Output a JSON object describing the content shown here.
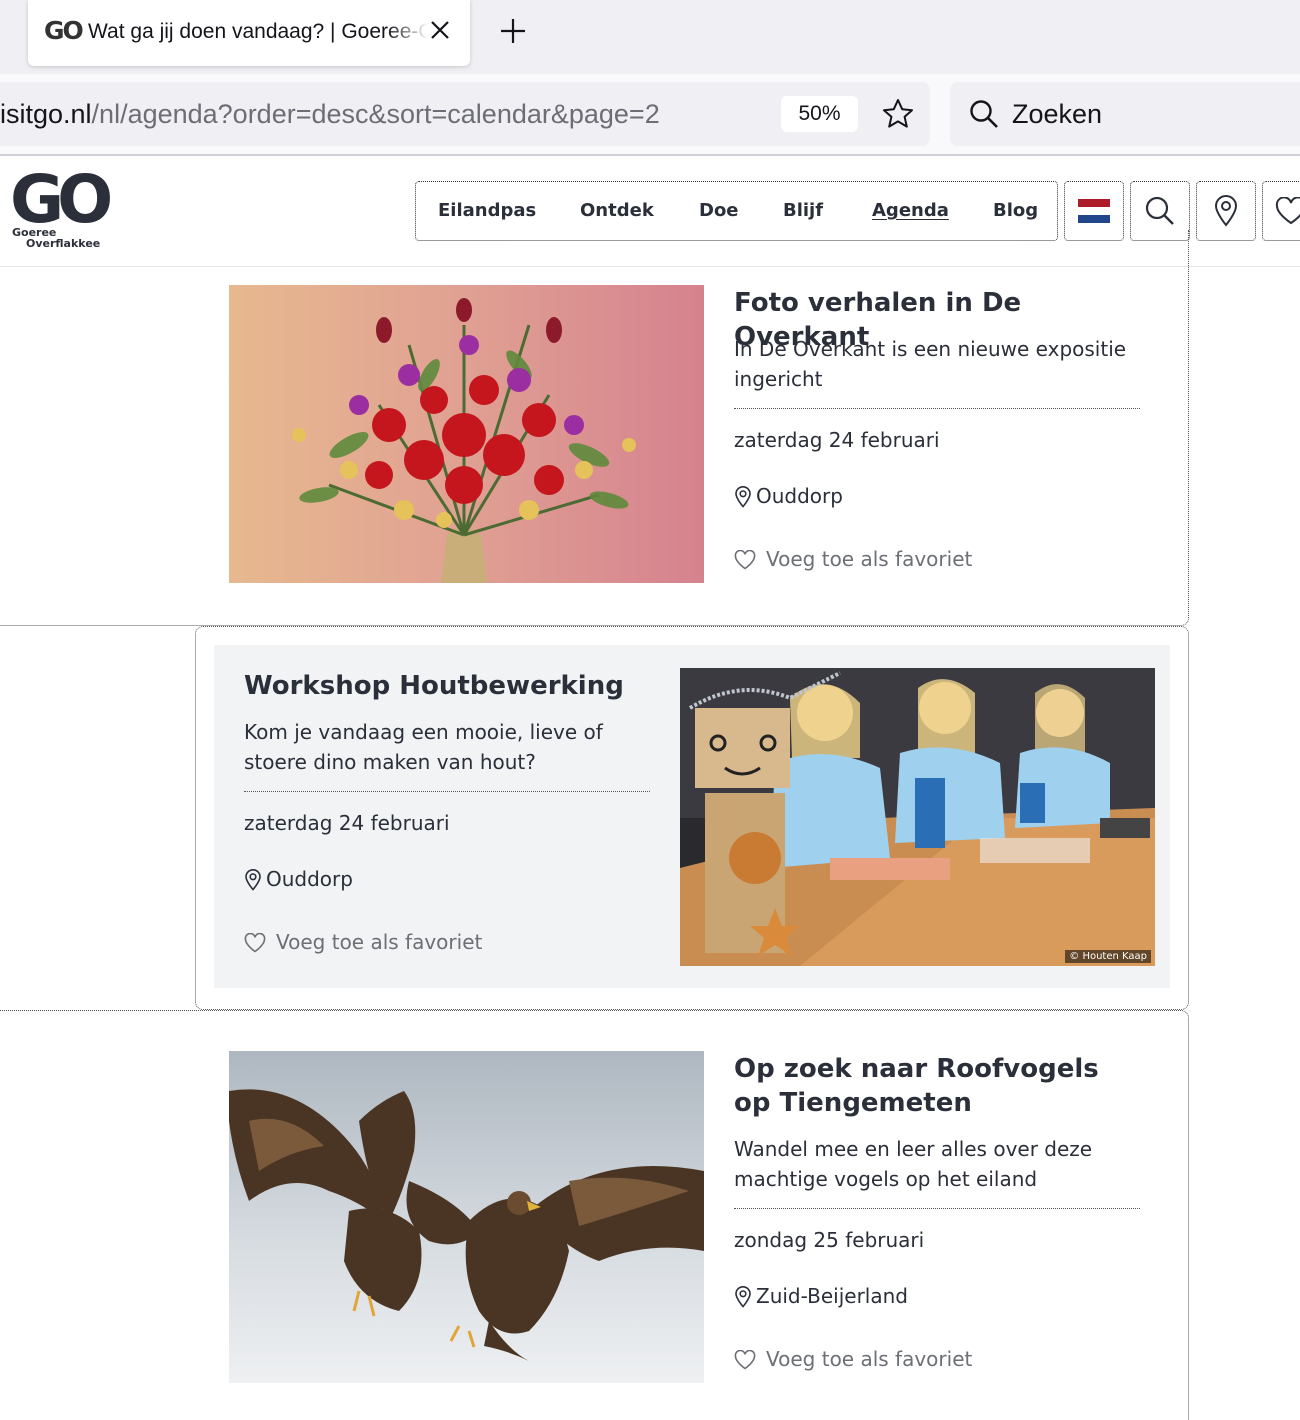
{
  "browser": {
    "tab_title": "Wat ga jij doen vandaag? | Goeree-Overflakkee",
    "favicon_text": "GO",
    "url_host": "isitgo.nl",
    "url_path": "/nl/agenda?order=desc&sort=calendar&page=2",
    "zoom": "50%",
    "search_placeholder": "Zoeken"
  },
  "site": {
    "logo_text": "GO",
    "logo_sub1": "Goeree",
    "logo_sub2": "Overflakkee",
    "nav": [
      {
        "label": "Eilandpas"
      },
      {
        "label": "Ontdek"
      },
      {
        "label": "Doe"
      },
      {
        "label": "Blijf"
      },
      {
        "label": "Agenda",
        "active": true
      },
      {
        "label": "Blog"
      }
    ],
    "icons": [
      "flag-nl-icon",
      "search-icon",
      "map-pin-icon",
      "heart-icon"
    ]
  },
  "events": [
    {
      "title": "Foto verhalen in De Overkant",
      "description": "In De Overkant is een nieuwe expositie ingericht",
      "date": "zaterdag 24 februari",
      "location": "Ouddorp",
      "favorite_label": "Voeg toe als favoriet"
    },
    {
      "title": "Workshop Houtbewerking",
      "description": "Kom je vandaag een mooie, lieve of stoere dino maken van hout?",
      "date": "zaterdag 24 februari",
      "location": "Ouddorp",
      "favorite_label": "Voeg toe als favoriet",
      "image_credit": "© Houten Kaap"
    },
    {
      "title": "Op zoek naar Roofvogels op Tiengemeten",
      "description": "Wandel mee en leer alles over deze machtige vogels op het eiland",
      "date": "zondag 25 februari",
      "location": "Zuid-Beijerland",
      "favorite_label": "Voeg toe als favoriet"
    }
  ],
  "colors": {
    "text": "#2b2f3a",
    "muted": "#6c6f75",
    "panel": "#f1f3f4",
    "chrome": "#f0f0f4"
  }
}
